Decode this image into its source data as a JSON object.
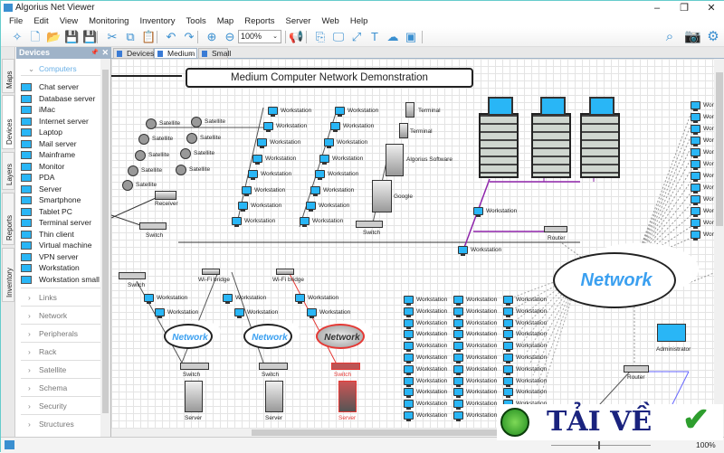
{
  "window": {
    "title": "Algorius Net Viewer",
    "minimize": "–",
    "restore": "❐",
    "close": "✕"
  },
  "menu": [
    "File",
    "Edit",
    "View",
    "Monitoring",
    "Inventory",
    "Tools",
    "Map",
    "Reports",
    "Server",
    "Web",
    "Help"
  ],
  "toolbar": {
    "zoom_value": "100%",
    "icons": [
      "wand-icon",
      "new-file-icon",
      "open-folder-icon",
      "save-icon",
      "save-all-icon",
      "cut-icon",
      "copy-icon",
      "paste-icon",
      "undo-icon",
      "redo-icon",
      "zoom-in-icon",
      "zoom-out-icon",
      "megaphone-icon",
      "link-icon",
      "monitor-add-icon",
      "resize-icon",
      "text-add-icon",
      "cloud-add-icon",
      "image-add-icon"
    ],
    "right_icons": [
      "search-icon",
      "camera-icon",
      "gear-icon"
    ]
  },
  "side_tabs": [
    "Maps",
    "Devices",
    "Layers",
    "Reports",
    "Inventory"
  ],
  "panel": {
    "title": "Devices",
    "section": "Computers",
    "items": [
      "Chat server",
      "Database server",
      "iMac",
      "Internet server",
      "Laptop",
      "Mail server",
      "Mainframe",
      "Monitor",
      "PDA",
      "Server",
      "Smartphone",
      "Tablet PC",
      "Terminal server",
      "Thin client",
      "Virtual machine",
      "VPN server",
      "Workstation",
      "Workstation small"
    ],
    "categories": [
      "Links",
      "Network",
      "Peripherals",
      "Rack",
      "Satellite",
      "Schema",
      "Security",
      "Structures"
    ]
  },
  "tabs": [
    {
      "label": "Devices"
    },
    {
      "label": "Medium",
      "close": "×"
    },
    {
      "label": "Small"
    }
  ],
  "diagram": {
    "title": "Medium Computer Network Demonstration",
    "labels": {
      "satellite": "Satellite",
      "receiver": "Receiver",
      "switch": "Switch",
      "workstation": "Workstation",
      "terminal": "Terminal",
      "algorius": "Algorius Software",
      "google": "Google",
      "router": "Router",
      "network": "Network",
      "wifi": "Wi-Fi bridge",
      "server": "Server",
      "administrator": "Administrator"
    }
  },
  "status": {
    "zoom": "100%"
  },
  "watermark": {
    "text": "TẢI VỀ"
  },
  "colors": {
    "accent": "#3a8fd0",
    "cloud_text": "#3ba0f0",
    "alert": "#e53935",
    "link": "#8e24aa"
  }
}
